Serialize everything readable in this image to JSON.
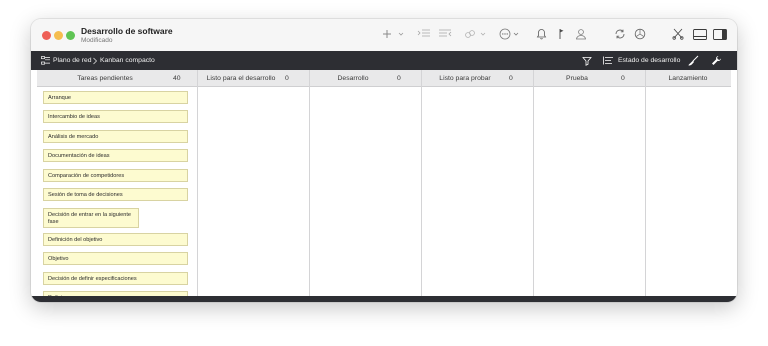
{
  "window": {
    "title": "Desarrollo de software",
    "subtitle": "Modificado"
  },
  "toolbar": {
    "icons": [
      "plus-icon",
      "chevron-down-icon",
      "indent-icon",
      "outdent-icon",
      "link-icon",
      "chevron-down-icon",
      "more-icon",
      "bell-icon",
      "flag-icon",
      "person-icon",
      "sync-icon",
      "progress-icon",
      "scissors-icon",
      "layout-bottom-icon",
      "layout-sidebar-icon"
    ]
  },
  "nav": {
    "breadcrumb_root": "Plano de red",
    "breadcrumb_current": "Kanban compacto",
    "status_label": "Estado de desarrollo"
  },
  "columns": [
    {
      "name": "Tareas pendientes",
      "count": "40"
    },
    {
      "name": "Listo para el desarrollo",
      "count": "0"
    },
    {
      "name": "Desarrollo",
      "count": "0"
    },
    {
      "name": "Listo para probar",
      "count": "0"
    },
    {
      "name": "Prueba",
      "count": "0"
    },
    {
      "name": "Lanzamiento",
      "count": ""
    }
  ],
  "cards": [
    "Arranque",
    "Intercambio de ideas",
    "Análisis de mercado",
    "Documentación de ideas",
    "Comparación de competidores",
    "Sesión de toma de decisiones",
    "Decisión de entrar en la siguiente fase",
    "Definición del objetivo",
    "Objetivo",
    "Decisión de definir especificaciones",
    "Definir proceso"
  ],
  "colors": {
    "navbar": "#2d2e33",
    "card_bg": "#fdfbd0",
    "header_bg": "#e9e9ea"
  }
}
